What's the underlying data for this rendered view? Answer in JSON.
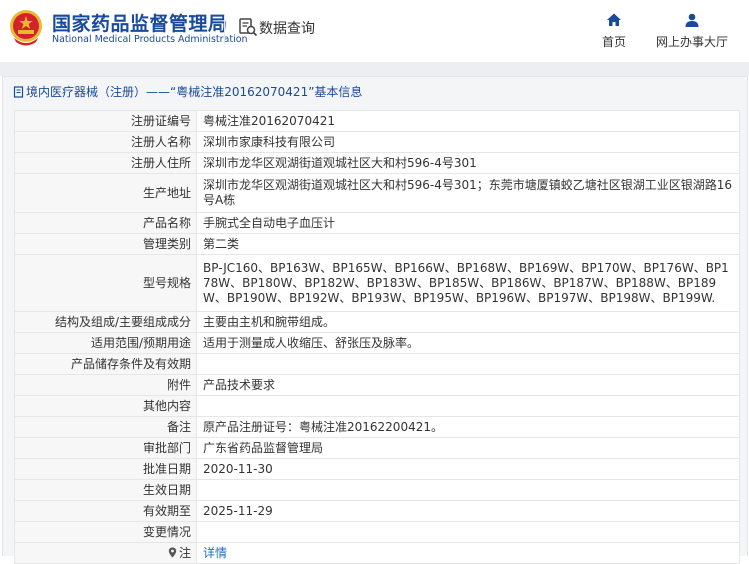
{
  "header": {
    "org_name_cn": "国家药品监督管理局",
    "org_name_en": "National Medical Products Administration",
    "section_label": "数据查询",
    "nav": [
      {
        "label": "首页",
        "icon": "home-icon"
      },
      {
        "label": "网上办事大厅",
        "icon": "user-icon"
      }
    ]
  },
  "panel": {
    "title": "境内医疗器械（注册）——“粤械注准20162070421”基本信息"
  },
  "details": {
    "rows": [
      {
        "label": "注册证编号",
        "value": "粤械注准20162070421"
      },
      {
        "label": "注册人名称",
        "value": "深圳市家康科技有限公司"
      },
      {
        "label": "注册人住所",
        "value": "深圳市龙华区观湖街道观城社区大和村596-4号301"
      },
      {
        "label": "生产地址",
        "value": "深圳市龙华区观湖街道观城社区大和村596-4号301；东莞市塘厦镇蛟乙塘社区银湖工业区银湖路16号A栋"
      },
      {
        "label": "产品名称",
        "value": "手腕式全自动电子血压计"
      },
      {
        "label": "管理类别",
        "value": "第二类"
      },
      {
        "label": "型号规格",
        "value": "BP-JC160、BP163W、BP165W、BP166W、BP168W、BP169W、BP170W、BP176W、BP178W、BP180W、BP182W、BP183W、BP185W、BP186W、BP187W、BP188W、BP189W、BP190W、BP192W、BP193W、BP195W、BP196W、BP197W、BP198W、BP199W."
      },
      {
        "label": "结构及组成/主要组成成分",
        "value": "主要由主机和腕带组成。"
      },
      {
        "label": "适用范围/预期用途",
        "value": "适用于测量成人收缩压、舒张压及脉率。"
      },
      {
        "label": "产品储存条件及有效期",
        "value": ""
      },
      {
        "label": "附件",
        "value": "产品技术要求"
      },
      {
        "label": "其他内容",
        "value": ""
      },
      {
        "label": "备注",
        "value": "原产品注册证号：粤械注准20162200421。"
      },
      {
        "label": "审批部门",
        "value": "广东省药品监督管理局"
      },
      {
        "label": "批准日期",
        "value": "2020-11-30"
      },
      {
        "label": "生效日期",
        "value": ""
      },
      {
        "label": "有效期至",
        "value": "2025-11-29"
      },
      {
        "label": "变更情况",
        "value": ""
      }
    ],
    "note_label": "注",
    "note_link": "详情"
  },
  "colors": {
    "brand_blue": "#1a4a9c",
    "emblem_red": "#d3232a",
    "emblem_gold": "#e8b931",
    "link_blue": "#1a6ec8"
  }
}
